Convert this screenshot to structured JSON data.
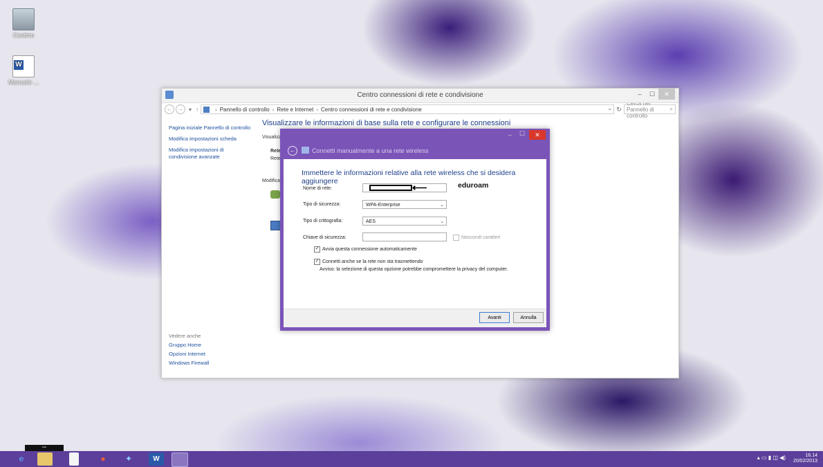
{
  "desktop": {
    "icons": [
      {
        "label": "Cestino",
        "icon": "recycle-bin-icon"
      },
      {
        "label": "Manuale ...",
        "icon": "word-document-icon"
      }
    ]
  },
  "window": {
    "title": "Centro connessioni di rete e condivisione",
    "minimize": "–",
    "maximize": "☐",
    "close": "✕",
    "breadcrumb": [
      "Pannello di controllo",
      "Rete e Internet",
      "Centro connessioni di rete e condivisione"
    ],
    "search_placeholder": "Cerca nel Pannello di controllo",
    "sidebar": [
      "Pagina iniziale Pannello di controllo",
      "Modifica impostazioni scheda",
      "Modifica impostazioni di condivisione avanzate"
    ],
    "see_also": {
      "heading": "Vedere anche",
      "links": [
        "Gruppo Home",
        "Opzioni Internet",
        "Windows Firewall"
      ]
    },
    "main_heading": "Visualizzare le informazioni di base sulla rete e configurare le connessioni",
    "fragments": {
      "visualizza": "Visualizz",
      "rete_bold": "Rete",
      "rete": "Rete",
      "modifica": "Modifica"
    }
  },
  "dialog": {
    "title": "Connetti manualmente a una rete wireless",
    "minimize": "–",
    "maximize": "☐",
    "close": "✕",
    "heading": "Immettere le informazioni relative alla rete wireless che si desidera aggiungere",
    "fields": {
      "network_name_label": "Nome di rete:",
      "security_type_label": "Tipo di sicurezza:",
      "security_type_value": "WPA-Enterprise",
      "encryption_type_label": "Tipo di crittografia:",
      "encryption_type_value": "AES",
      "security_key_label": "Chiave di sicurezza:",
      "hide_chars_label": "Nascondi caratteri"
    },
    "annotation": "eduroam",
    "options": {
      "auto_connect": "Avvia questa connessione automaticamente",
      "auto_connect_checked": true,
      "connect_hidden": "Connetti anche se la rete non sta trasmettendo",
      "connect_hidden_checked": true,
      "warning": "Avviso: la selezione di questa opzione potrebbe compromettere la privacy del computer."
    },
    "buttons": {
      "next": "Avanti",
      "cancel": "Annulla"
    }
  },
  "taskbar": {
    "items": [
      "internet-explorer-icon",
      "file-explorer-icon",
      "document-icon",
      "paint-icon",
      "network-icon",
      "word-icon",
      "control-panel-icon"
    ],
    "time": "16.14",
    "date": "20/02/2013"
  },
  "colors": {
    "accent": "#7b54b8",
    "link": "#1a4f9c",
    "heading": "#1e3f8a",
    "close_red": "#d9372a",
    "taskbar": "#5b3f9a"
  }
}
